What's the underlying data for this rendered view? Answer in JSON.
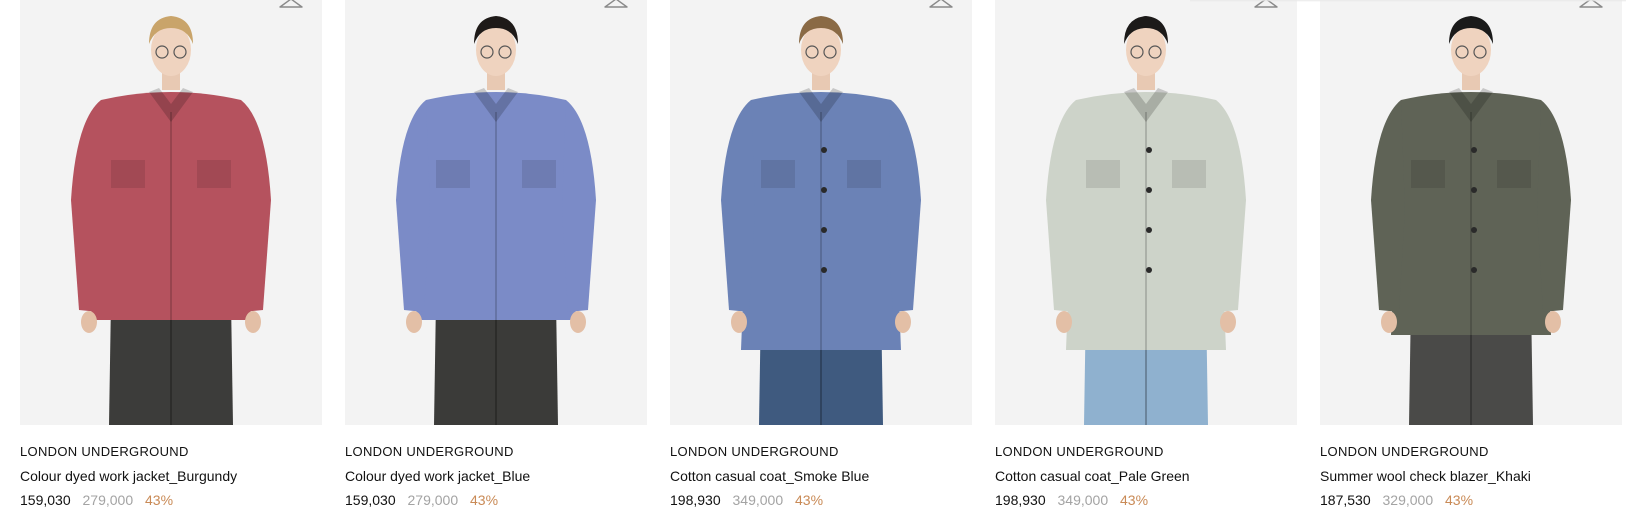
{
  "products": [
    {
      "brand": "LONDON UNDERGROUND",
      "name": "Colour dyed work jacket_Burgundy",
      "sale_price": "159,030",
      "original_price": "279,000",
      "discount": "43%",
      "garment_color": "#b5525e",
      "lower_color": "#3c3c3a",
      "hair_color": "#c9a46a",
      "garment_type": "jacket"
    },
    {
      "brand": "LONDON UNDERGROUND",
      "name": "Colour dyed work jacket_Blue",
      "sale_price": "159,030",
      "original_price": "279,000",
      "discount": "43%",
      "garment_color": "#7b8bc7",
      "lower_color": "#3b3b39",
      "hair_color": "#1e1a18",
      "garment_type": "jacket"
    },
    {
      "brand": "LONDON UNDERGROUND",
      "name": "Cotton casual coat_Smoke Blue",
      "sale_price": "198,930",
      "original_price": "349,000",
      "discount": "43%",
      "garment_color": "#6b82b6",
      "lower_color": "#3f5a7f",
      "hair_color": "#8a6a45",
      "garment_type": "coat"
    },
    {
      "brand": "LONDON UNDERGROUND",
      "name": "Cotton casual coat_Pale Green",
      "sale_price": "198,930",
      "original_price": "349,000",
      "discount": "43%",
      "garment_color": "#cdd3c9",
      "lower_color": "#8fb1cf",
      "hair_color": "#1c1a19",
      "garment_type": "coat"
    },
    {
      "brand": "LONDON UNDERGROUND",
      "name": "Summer wool check blazer_Khaki",
      "sale_price": "187,530",
      "original_price": "329,000",
      "discount": "43%",
      "garment_color": "#5f6356",
      "lower_color": "#4a4a48",
      "hair_color": "#1a1a1a",
      "garment_type": "blazer"
    }
  ],
  "icons": {
    "wishlist": "hanger-icon"
  },
  "colors": {
    "discount": "#c98a56",
    "original_price": "#a3a3a3",
    "image_bg": "#f3f3f3"
  }
}
